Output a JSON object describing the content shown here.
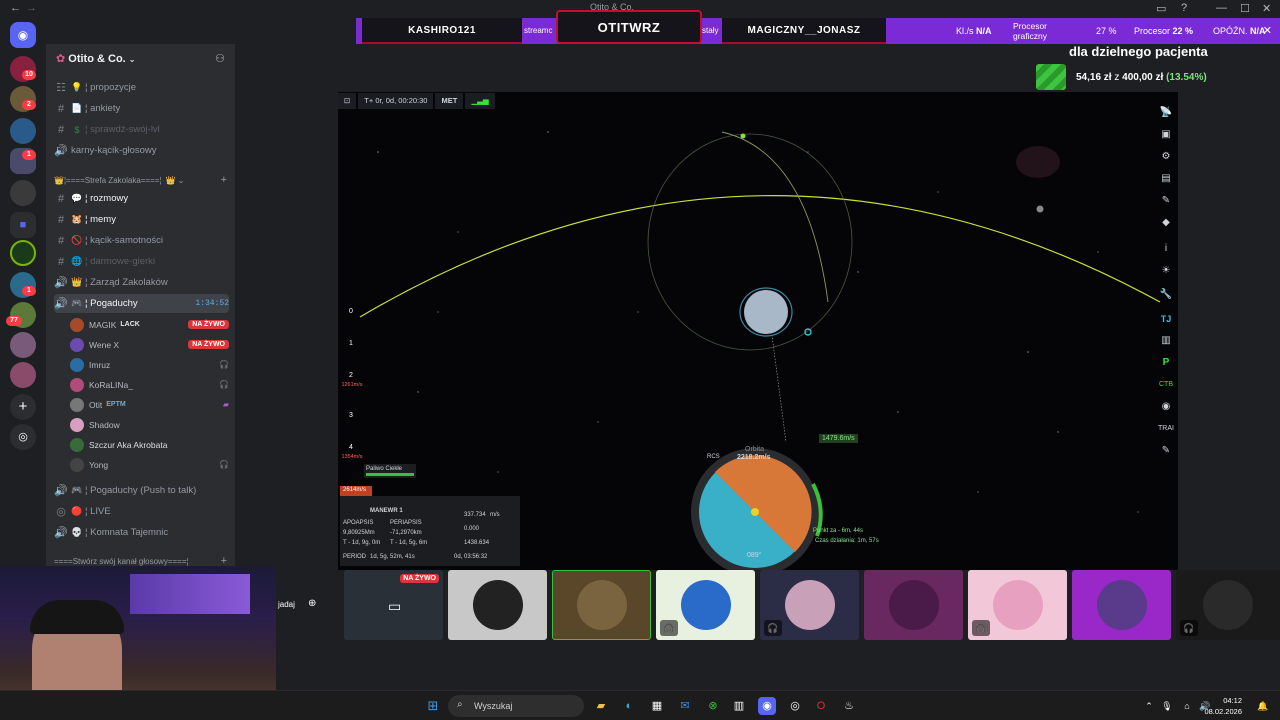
{
  "titlebar": {
    "title": "Otito & Co."
  },
  "server": {
    "name": "Otito & Co."
  },
  "rail": {
    "badges": [
      "10",
      "2",
      "1",
      "1",
      "1",
      "77"
    ]
  },
  "channels": {
    "top": [
      {
        "icon": "💡",
        "name": "¦ propozycje",
        "style": "normal"
      },
      {
        "icon": "📄",
        "name": "¦ ankiety",
        "style": "normal"
      },
      {
        "icon": "$",
        "name": "¦ sprawdź-swój-lvl",
        "style": "dim"
      },
      {
        "icon": "",
        "name": "karny-kącik-głosowy",
        "style": "normal"
      }
    ],
    "category": "¦====Strefa Zakolaka====¦",
    "list": [
      {
        "icon": "💬",
        "name": "¦ rozmowy",
        "style": "bright"
      },
      {
        "icon": "🐹",
        "name": "¦ memy",
        "style": "bright"
      },
      {
        "icon": "🚫",
        "name": "¦ kącik-samotności",
        "style": "normal"
      },
      {
        "icon": "🌐",
        "name": "¦ darmowe-gierki",
        "style": "dim"
      },
      {
        "icon": "👑",
        "name": "¦ Zarząd Zakolaków",
        "style": "normal"
      },
      {
        "icon": "🎮",
        "name": "¦ Pogaduchy",
        "style": "active",
        "timer": "1:34:52"
      }
    ],
    "voice_users": [
      {
        "name": "MAGIK",
        "tag": "LACK",
        "live": "NA ŻYWO",
        "color": "#a64b2a"
      },
      {
        "name": "Wene X",
        "tag": "",
        "live": "NA ŻYWO",
        "color": "#6c4bb0"
      },
      {
        "name": "Imruz",
        "tag": "",
        "live": "",
        "color": "#2a6ca6"
      },
      {
        "name": "KoRaLINa_",
        "tag": "",
        "live": "",
        "color": "#b04b7a"
      },
      {
        "name": "Otit",
        "tag": "EPTM",
        "live": "",
        "color": "#777777"
      },
      {
        "name": "Shadow",
        "tag": "",
        "live": "",
        "color": "#d8a0c0"
      },
      {
        "name": "Szczur Aka Akrobata",
        "tag": "",
        "live": "",
        "color": "#3a6a3a"
      },
      {
        "name": "Yong",
        "tag": "",
        "live": "",
        "color": "#444444"
      }
    ],
    "bottom": [
      {
        "icon": "🎮",
        "name": "¦ Pogaduchy (Push to talk)"
      },
      {
        "icon": "🔴",
        "name": "¦ LIVE"
      },
      {
        "icon": "💀",
        "name": "¦ Komnata Tajemnic"
      }
    ],
    "footer_category": "====Stwórz swój kanał głosowy====¦"
  },
  "banner": {
    "left_name": "KASHIRO121",
    "center_name": "OTITWRZ",
    "right_name": "MAGICZNY__JONASZ",
    "left_fragment": "streamc",
    "right_fragment": "stały",
    "stats": [
      {
        "label": "Kl./s",
        "value": "N/A"
      },
      {
        "label": "Procesor graficzny",
        "value": "27 %"
      },
      {
        "label": "Procesor",
        "value": "22 %"
      },
      {
        "label": "OPÓŹN.",
        "value": "N/A"
      }
    ]
  },
  "donation": {
    "title": "dla dzielnego pacjenta",
    "amount": "54,16 zł",
    "of": "z",
    "goal": "400,00 zł",
    "percent": "(13.54%)",
    "progress": 0.1354
  },
  "game": {
    "met_time": "T+ 0r, 0d, 00:20:30",
    "met_label": "MET",
    "stages": [
      "0",
      "1",
      "2",
      "3",
      "4"
    ],
    "speed_a": "1261m/s",
    "speed_b": "1354m/s",
    "speed_c": "2614m/s",
    "fuel_label": "Paliwo Ciekłe",
    "maneuver": {
      "title": "MANEWR 1",
      "apo_label": "APOAPSIS",
      "peri_label": "PERIAPSIS",
      "apo_val": "9,80925Mm",
      "peri_val": "-71,2970km",
      "apo_t": "T - 1d, 9g, 0m",
      "peri_t": "T - 1d, 5g, 6m",
      "dv1": "337.734",
      "dv2": "0.000",
      "dv3": "1438.634",
      "unit": "m/s",
      "period_label": "PERIOD",
      "period_val": "1d, 5g, 52m, 41s",
      "period_val2": "0d, 03:56:32"
    },
    "navball": {
      "mode": "Orbita",
      "speed": "2218.2m/s",
      "rcs": "RCS",
      "heading": "089°",
      "dv_burn": "1479.6m/s",
      "burn_point": "Punkt za - 6m, 44s",
      "burn_time": "Czas działania: 1m, 57s"
    }
  },
  "tiles": [
    {
      "kind": "partial",
      "label": "jadaj"
    },
    {
      "kind": "stream",
      "live": "NA ŻYWO"
    },
    {
      "kind": "avatar",
      "bg": "#c8c8c8"
    },
    {
      "kind": "avatar",
      "bg": "#5a4628"
    },
    {
      "kind": "avatar",
      "bg": "#e8f0e0"
    },
    {
      "kind": "avatar",
      "bg": "#2b2d47"
    },
    {
      "kind": "avatar",
      "bg": "#6a2860"
    },
    {
      "kind": "avatar",
      "bg": "#f2c8d8"
    },
    {
      "kind": "avatar",
      "bg": "#9a28c8"
    },
    {
      "kind": "avatar",
      "bg": "#1a1a1a"
    }
  ],
  "taskbar": {
    "search_placeholder": "Wyszukaj",
    "time": "04:12",
    "date": "08.02.2026"
  }
}
